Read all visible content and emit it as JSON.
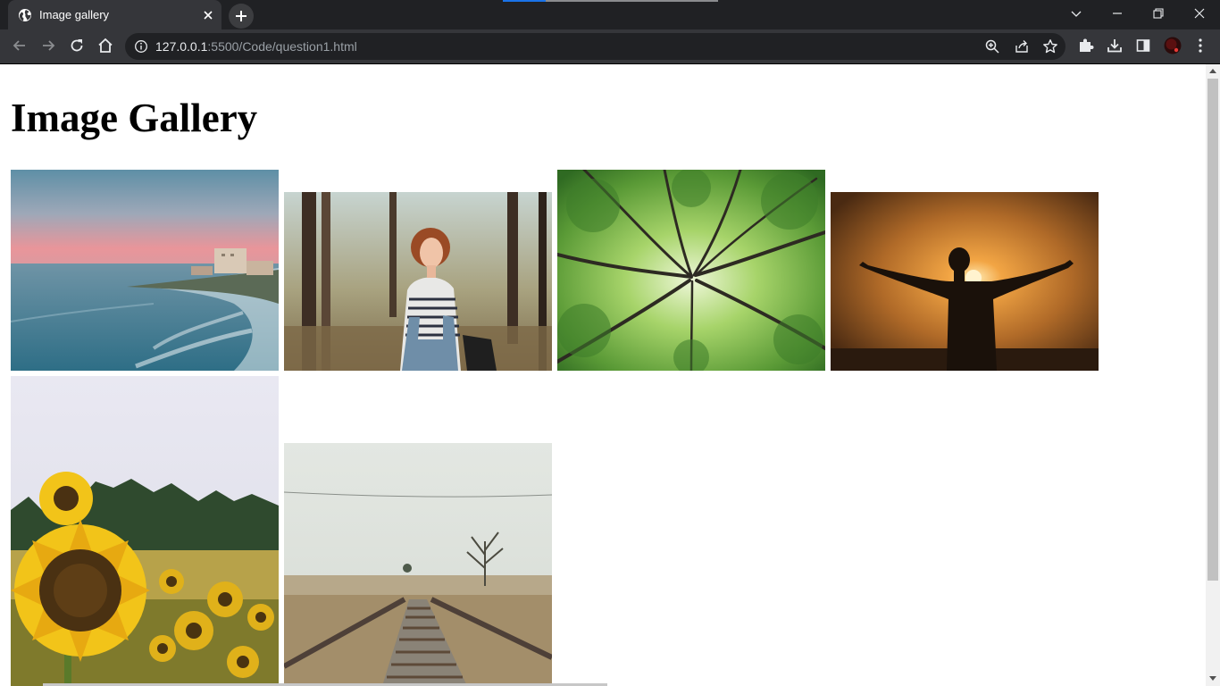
{
  "browser": {
    "tab": {
      "title": "Image gallery"
    },
    "address": {
      "host": "127.0.0.1",
      "rest": ":5500/Code/question1.html"
    }
  },
  "page": {
    "title": "Image Gallery",
    "images": [
      {
        "subject": "sunset-coast-photo"
      },
      {
        "subject": "woman-in-forest-photo"
      },
      {
        "subject": "tree-canopy-photo"
      },
      {
        "subject": "silhouette-sunrise-photo"
      },
      {
        "subject": "sunflower-field-photo"
      },
      {
        "subject": "railway-tracks-photo"
      }
    ]
  },
  "colors": {
    "browser_frame": "#202124",
    "active_tab": "#35363a",
    "page_background": "#ffffff",
    "heading": "#000000"
  }
}
